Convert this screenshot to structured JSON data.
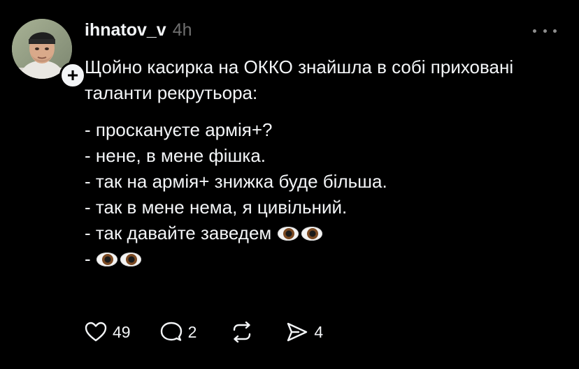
{
  "post": {
    "author": {
      "username": "ihnatov_v",
      "avatar_icon": "profile-photo"
    },
    "timestamp": "4h",
    "follow_icon": "+",
    "intro": "Щойно касирка на ОККО знайшла в собі приховані таланти рекрутьора:",
    "lines": [
      "- проскануєте армія+?",
      "- нене, в мене фішка.",
      "- так на армія+ знижка буде більша.",
      "- так в мене нема, я цивільний.",
      "- так давайте заведем",
      "-"
    ],
    "emoji": "👀"
  },
  "actions": {
    "likes": "49",
    "replies": "2",
    "shares": "4"
  },
  "colors": {
    "background": "#000000",
    "text": "#f3f5f7",
    "muted": "#6f6f6f"
  }
}
